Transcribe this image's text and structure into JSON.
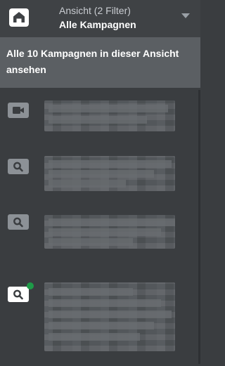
{
  "header": {
    "view_label": "Ansicht (2 Filter)",
    "view_value": "Alle Kampagnen"
  },
  "view_all": {
    "text": "Alle 10 Kampagnen in dieser Ansicht ansehen"
  },
  "campaigns": [
    {
      "icon": "video-camera-icon",
      "active": false,
      "status": ""
    },
    {
      "icon": "search-icon",
      "active": false,
      "status": ""
    },
    {
      "icon": "search-icon",
      "active": false,
      "status": ""
    },
    {
      "icon": "search-icon",
      "active": true,
      "status": "green"
    }
  ],
  "colors": {
    "panel_bg": "#3a3d40",
    "highlight_bg": "#5b5f63",
    "status_green": "#1e9b48"
  }
}
